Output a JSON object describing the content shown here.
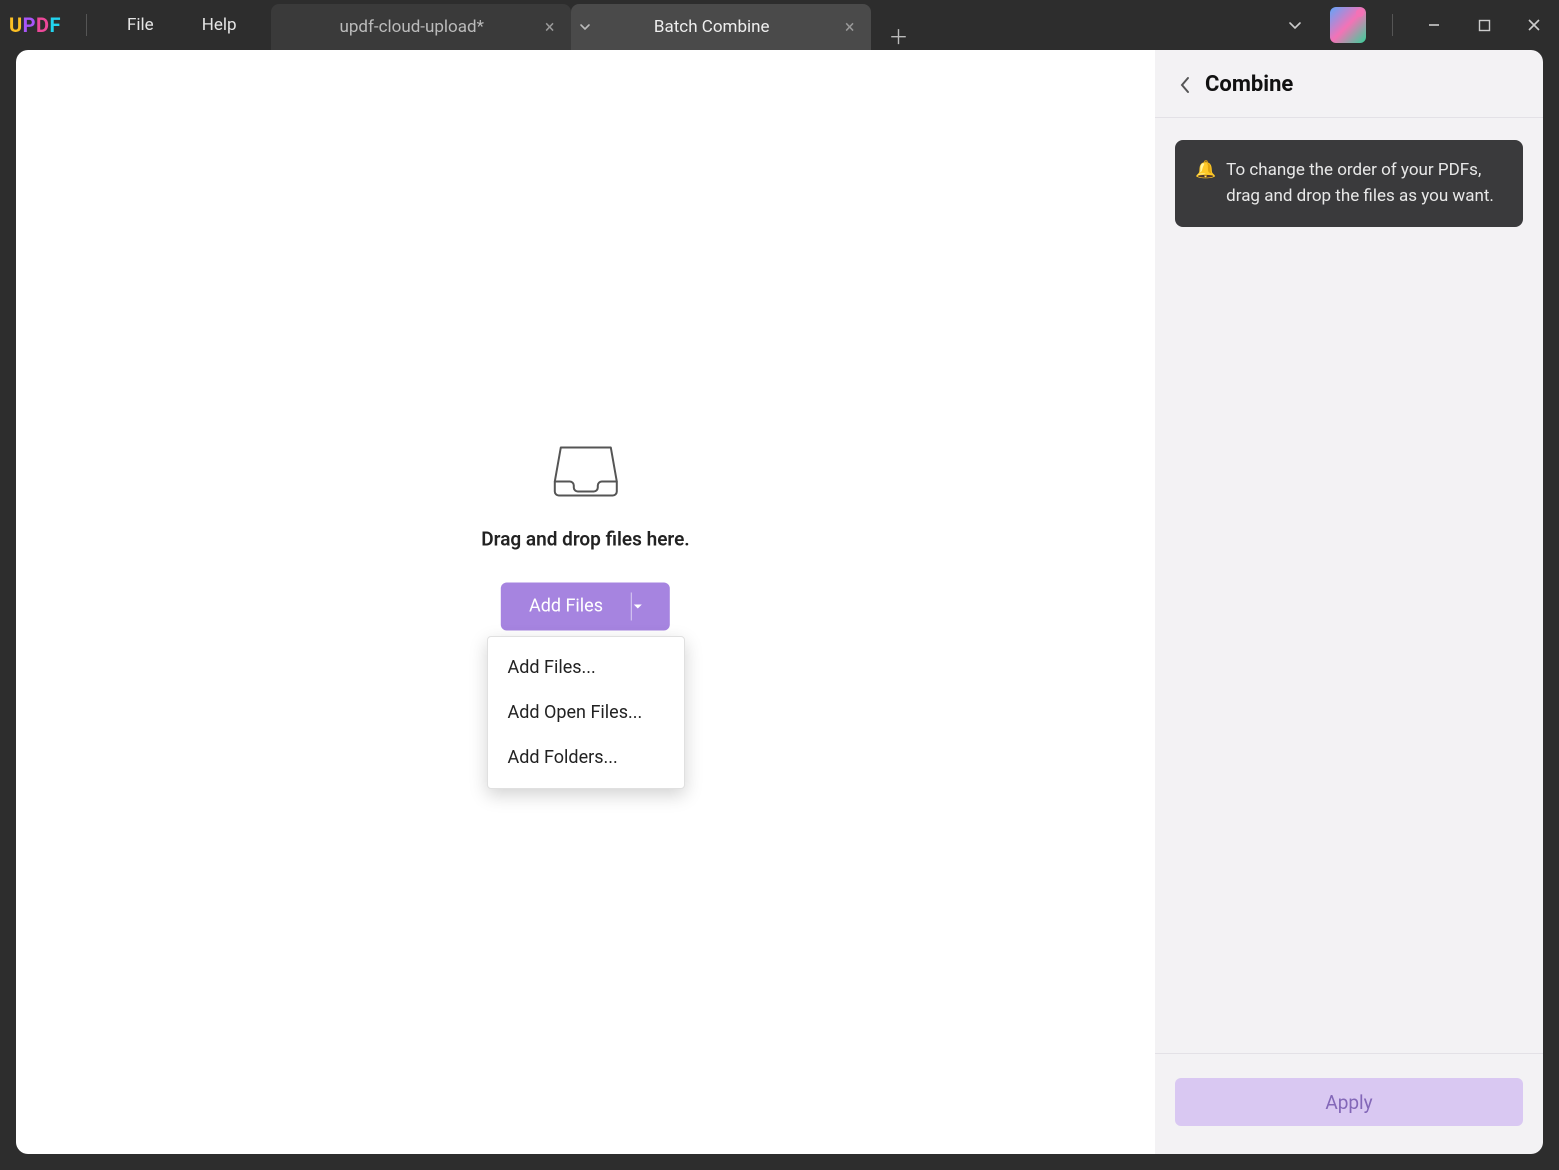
{
  "logo": {
    "u": "U",
    "p": "P",
    "d": "D",
    "f": "F"
  },
  "menu": {
    "file": "File",
    "help": "Help"
  },
  "tabs": [
    {
      "label": "updf-cloud-upload*",
      "active": false
    },
    {
      "label": "Batch Combine",
      "active": true
    }
  ],
  "dropzone": {
    "caption": "Drag and drop files here.",
    "button_label": "Add Files",
    "menu": {
      "add_files": "Add Files...",
      "add_open_files": "Add Open Files...",
      "add_folders": "Add Folders..."
    }
  },
  "sidebar": {
    "title": "Combine",
    "tip_icon": "🔔",
    "tip_text": "To change the order of your PDFs, drag and drop the files as you want.",
    "apply_label": "Apply"
  },
  "colors": {
    "accent": "#a684e0",
    "accent_disabled": "#d9c8f2",
    "titlebar_bg": "#2d2d2d"
  }
}
